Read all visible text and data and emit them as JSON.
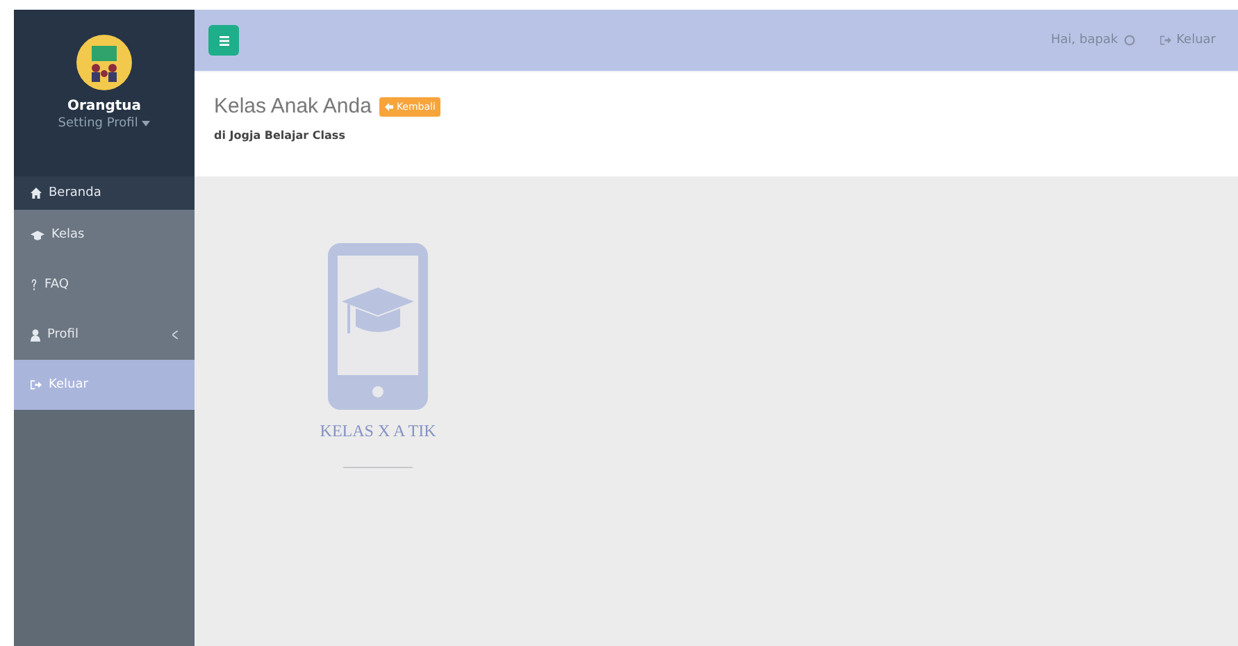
{
  "topbar": {
    "greeting": "Hai, bapak",
    "logout": "Keluar"
  },
  "sidebar": {
    "user": {
      "name": "Orangtua",
      "setting": "Setting Profil"
    },
    "items": [
      {
        "label": "Beranda",
        "kind": "home",
        "selected": false,
        "expandable": false
      },
      {
        "label": "Kelas",
        "kind": "cap",
        "selected": false,
        "expandable": false
      },
      {
        "label": "FAQ",
        "kind": "question",
        "selected": false,
        "expandable": false
      },
      {
        "label": "Profil",
        "kind": "user",
        "selected": false,
        "expandable": true
      },
      {
        "label": "Keluar",
        "kind": "signout",
        "selected": true,
        "expandable": false
      }
    ]
  },
  "page": {
    "title": "Kelas Anak Anda",
    "back_button": "Kembali",
    "subtitle": "di Jogja Belajar Class"
  },
  "classes": [
    {
      "name": "KELAS X A TIK"
    }
  ]
}
